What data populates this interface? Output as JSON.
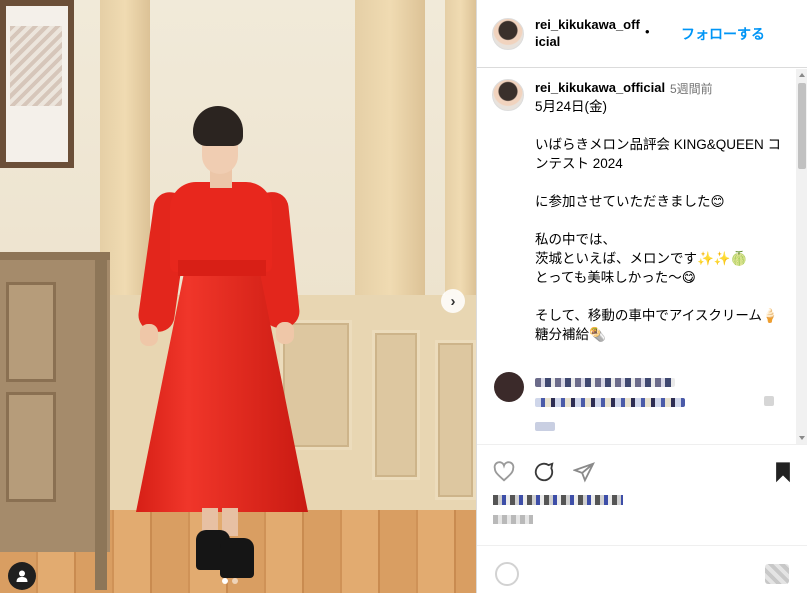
{
  "post": {
    "username": "rei_kikukawa_official",
    "follow_label": "フォローする",
    "separator": "•",
    "more_label": "···",
    "caption_time": "5週間前",
    "caption": "5月24日(金)\n\nいばらきメロン品評会 KING&QUEEN コンテスト 2024\n\nに参加させていただきました😊\n\n私の中では、\n茨城といえば、メロンです✨✨🍈\nとっても美味しかった〜😋\n\nそして、移動の車中でアイスクリーム🍦\n糖分補給🌯"
  },
  "media": {
    "next_arrow": "›",
    "carousel_pages": 2,
    "carousel_active": 1,
    "user_tag_icon": "person-icon"
  },
  "add_comment": {
    "placeholder": ""
  },
  "colors": {
    "accent": "#0095f6",
    "dress": "#e8271d",
    "border": "#dbdbdb"
  }
}
